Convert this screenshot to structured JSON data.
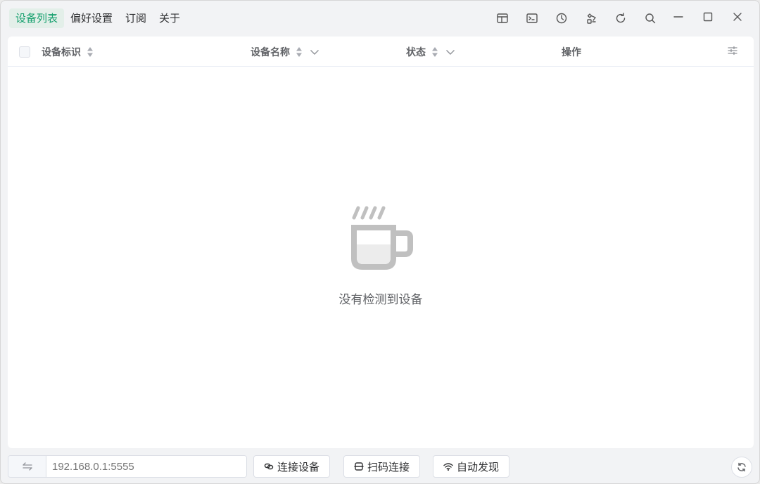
{
  "nav": {
    "items": [
      {
        "label": "设备列表",
        "active": true
      },
      {
        "label": "偏好设置",
        "active": false
      },
      {
        "label": "订阅",
        "active": false
      },
      {
        "label": "关于",
        "active": false
      }
    ]
  },
  "toolbar": {
    "icons": [
      "layout-icon",
      "terminal-icon",
      "history-icon",
      "tools-icon",
      "refresh-icon",
      "search-icon"
    ]
  },
  "window_controls": [
    "minimize-icon",
    "maximize-icon",
    "close-icon"
  ],
  "table": {
    "columns": [
      {
        "label": "设备标识",
        "sortable": true,
        "filterable": false
      },
      {
        "label": "设备名称",
        "sortable": true,
        "filterable": true
      },
      {
        "label": "状态",
        "sortable": true,
        "filterable": true
      },
      {
        "label": "操作",
        "sortable": false,
        "filterable": false
      }
    ],
    "rows": [],
    "empty_text": "没有检测到设备"
  },
  "bottom": {
    "address_placeholder": "192.168.0.1:5555",
    "connect_label": "连接设备",
    "scan_label": "扫码连接",
    "discover_label": "自动发现"
  },
  "colors": {
    "accent": "#16a06e",
    "active_bg": "#e3efe9",
    "window_bg": "#f2f3f5",
    "empty_icon": "#c0c0c0"
  }
}
